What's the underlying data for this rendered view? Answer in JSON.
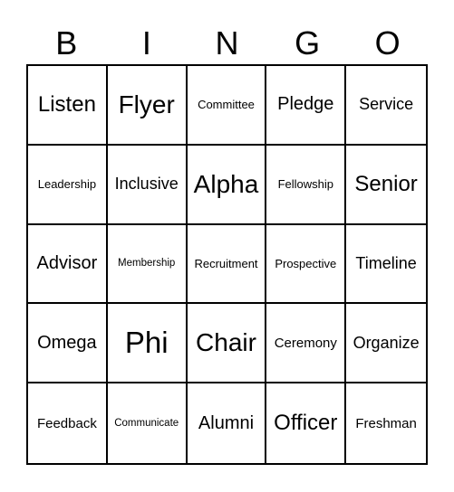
{
  "header": {
    "letters": [
      "B",
      "I",
      "N",
      "G",
      "O"
    ]
  },
  "card": {
    "rows": [
      [
        "Listen",
        "Flyer",
        "Committee",
        "Pledge",
        "Service"
      ],
      [
        "Leadership",
        "Inclusive",
        "Alpha",
        "Fellowship",
        "Senior"
      ],
      [
        "Advisor",
        "Membership",
        "Recruitment",
        "Prospective",
        "Timeline"
      ],
      [
        "Omega",
        "Phi",
        "Chair",
        "Ceremony",
        "Organize"
      ],
      [
        "Feedback",
        "Communicate",
        "Alumni",
        "Officer",
        "Freshman"
      ]
    ]
  }
}
